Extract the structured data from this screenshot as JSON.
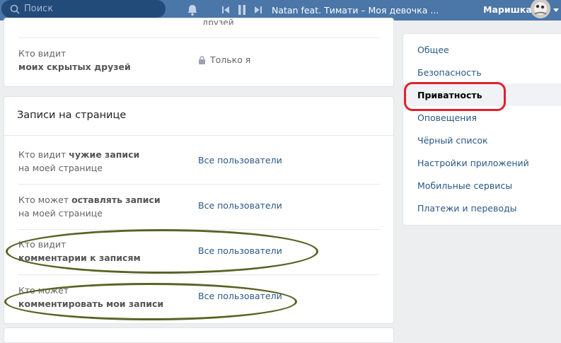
{
  "topbar": {
    "search_placeholder": "Поиск",
    "now_playing": "Natan feat. Тимати – Моя девочка ...",
    "user_name": "Маришка"
  },
  "hidden_friends": {
    "partial_text": "друзей",
    "label_plain": "Кто видит",
    "label_bold": "моих скрытых друзей",
    "value": "Только я",
    "value_icon": "lock-icon"
  },
  "wall_section": {
    "title": "Записи на странице",
    "rows": [
      {
        "label_plain": "Кто видит ",
        "label_bold": "чужие записи",
        "label_line2": "на моей странице",
        "value": "Все пользователи"
      },
      {
        "label_plain": "Кто может ",
        "label_bold": "оставлять записи",
        "label_line2": "на моей странице",
        "value": "Все пользователи"
      },
      {
        "label_plain": "Кто видит",
        "label_bold": "комментарии к записям",
        "value": "Все пользователи"
      },
      {
        "label_plain": "Кто может",
        "label_bold": "комментировать мои записи",
        "value": "Все пользователи"
      }
    ]
  },
  "settings_menu": {
    "items": [
      "Общее",
      "Безопасность",
      "Приватность",
      "Оповещения",
      "Чёрный список",
      "Настройки приложений",
      "Мобильные сервисы",
      "Платежи и переводы"
    ],
    "active": "Приватность"
  },
  "colors": {
    "header_bg": "#4a76a8",
    "link": "#2a5885",
    "highlight_red": "#e0202a",
    "highlight_olive": "#5a6224"
  }
}
